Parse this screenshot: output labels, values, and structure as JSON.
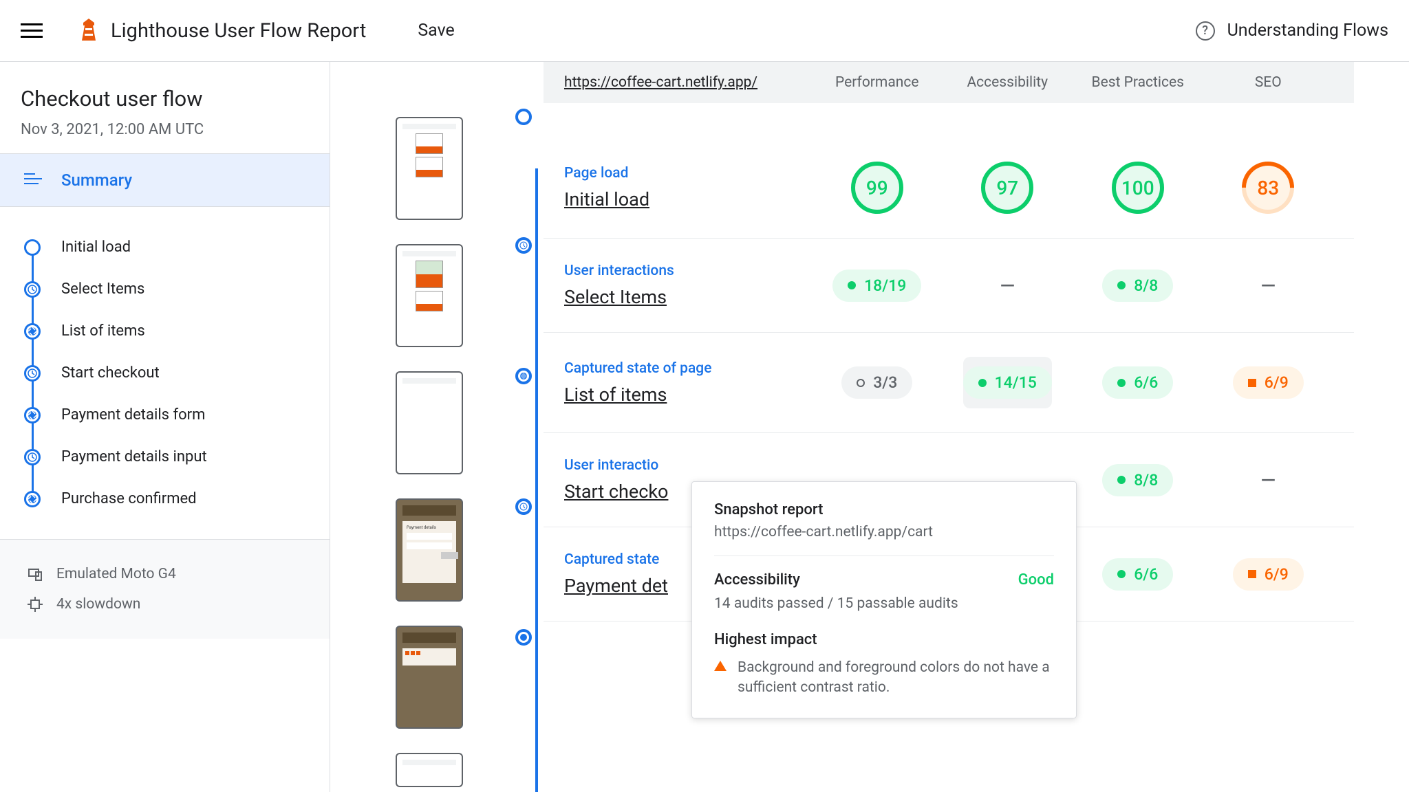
{
  "header": {
    "title": "Lighthouse User Flow Report",
    "save": "Save",
    "help": "Understanding Flows"
  },
  "sidebar": {
    "flow_title": "Checkout user flow",
    "flow_date": "Nov 3, 2021, 12:00 AM UTC",
    "summary": "Summary",
    "steps": [
      {
        "label": "Initial load",
        "icon": "circle"
      },
      {
        "label": "Select Items",
        "icon": "clock"
      },
      {
        "label": "List of items",
        "icon": "aperture"
      },
      {
        "label": "Start checkout",
        "icon": "clock"
      },
      {
        "label": "Payment details form",
        "icon": "aperture"
      },
      {
        "label": "Payment details input",
        "icon": "clock"
      },
      {
        "label": "Purchase confirmed",
        "icon": "aperture"
      }
    ],
    "env": {
      "device": "Emulated Moto G4",
      "cpu": "4x slowdown"
    }
  },
  "table": {
    "url": "https://coffee-cart.netlify.app/",
    "cols": [
      "Performance",
      "Accessibility",
      "Best Practices",
      "SEO"
    ],
    "rows": [
      {
        "type": "Page load",
        "name": "Initial load",
        "cells": [
          {
            "kind": "gauge",
            "value": "99",
            "tone": "green"
          },
          {
            "kind": "gauge",
            "value": "97",
            "tone": "green"
          },
          {
            "kind": "gauge",
            "value": "100",
            "tone": "green"
          },
          {
            "kind": "gauge",
            "value": "83",
            "tone": "orange"
          }
        ]
      },
      {
        "type": "User interactions",
        "name": "Select Items",
        "cells": [
          {
            "kind": "pill",
            "value": "18/19",
            "tone": "green"
          },
          {
            "kind": "dash"
          },
          {
            "kind": "pill",
            "value": "8/8",
            "tone": "green"
          },
          {
            "kind": "dash"
          }
        ]
      },
      {
        "type": "Captured state of page",
        "name": "List of items",
        "cells": [
          {
            "kind": "pill",
            "value": "3/3",
            "tone": "gray"
          },
          {
            "kind": "pill",
            "value": "14/15",
            "tone": "green",
            "hl": true
          },
          {
            "kind": "pill",
            "value": "6/6",
            "tone": "green"
          },
          {
            "kind": "pill",
            "value": "6/9",
            "tone": "orange"
          }
        ]
      },
      {
        "type": "User interactions",
        "name": "Start checkout",
        "truncated": "User interactio",
        "name_trunc": "Start checko",
        "cells": [
          null,
          null,
          {
            "kind": "pill",
            "value": "8/8",
            "tone": "green"
          },
          {
            "kind": "dash"
          }
        ]
      },
      {
        "type": "Captured state of page",
        "type_trunc": "Captured state",
        "name": "Payment details form",
        "name_trunc": "Payment det",
        "cells": [
          null,
          null,
          {
            "kind": "pill",
            "value": "6/6",
            "tone": "green"
          },
          {
            "kind": "pill",
            "value": "6/9",
            "tone": "orange"
          }
        ]
      }
    ]
  },
  "tooltip": {
    "title": "Snapshot report",
    "url": "https://coffee-cart.netlify.app/cart",
    "category": "Accessibility",
    "status": "Good",
    "audits": "14 audits passed / 15 passable audits",
    "impact_label": "Highest impact",
    "impact_text": "Background and foreground colors do not have a sufficient contrast ratio."
  }
}
